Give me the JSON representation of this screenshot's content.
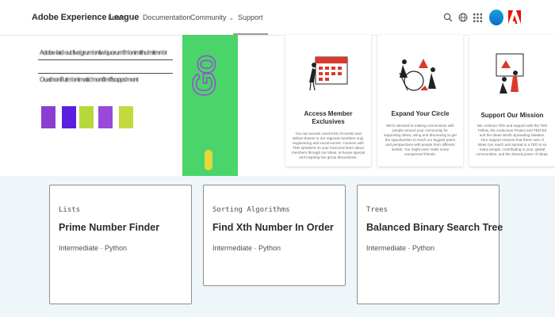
{
  "header": {
    "brand": "Adobe Experience League",
    "nav": [
      {
        "label": "Learn",
        "has_dropdown": true
      },
      {
        "label": "Documentation",
        "has_dropdown": false
      },
      {
        "label": "Community",
        "has_dropdown": true
      },
      {
        "label": "Support",
        "has_dropdown": false,
        "active": true
      }
    ],
    "icons": [
      "search-icon",
      "globe-icon",
      "apps-grid-icon",
      "avatar",
      "adobe-logo-icon"
    ],
    "colors": {
      "adobe_red": "#eb1000",
      "avatar_blue": "#1473e6"
    }
  },
  "banner": {
    "green_panel_color": "#4ad46a"
  },
  "features": [
    {
      "title": "Access Member Exclusives",
      "illustration": "calendar-illustration",
      "description": "You can access current list of events and deliver theses to our regional members only, engineering and social events. Connect with TED speakers on your local and learn about members through our ideas, in-house special and inspiring live group discussions."
    },
    {
      "title": "Expand Your Circle",
      "illustration": "people-circle-illustration",
      "description": "We're devoted to making connections with people around your community for supporting ideas, using and discussing to get the opportunities to reach our biggest peers and perspectives with people from different worlds. You might even make some unexpected friends."
    },
    {
      "title": "Support Our Mission",
      "illustration": "speakers-podium-illustration",
      "description": "We continue TED and support with the TED Fellow, the Audacious Project and TED-Ed and the Ideas Worth Spreading initiative. Your support ensures that these sets of ideas can reach and spread in a TED in so many people, contributing to your, global communities, and the shared power of ideas."
    }
  ],
  "cards": [
    {
      "category": "Lists",
      "title": "Prime Number Finder",
      "meta": "Intermediate · Python"
    },
    {
      "category": "Sorting Algorithms",
      "title": "Find Xth Number In Order",
      "meta": "Intermediate · Python"
    },
    {
      "category": "Trees",
      "title": "Balanced Binary Search Tree",
      "meta": "Intermediate · Python"
    }
  ]
}
